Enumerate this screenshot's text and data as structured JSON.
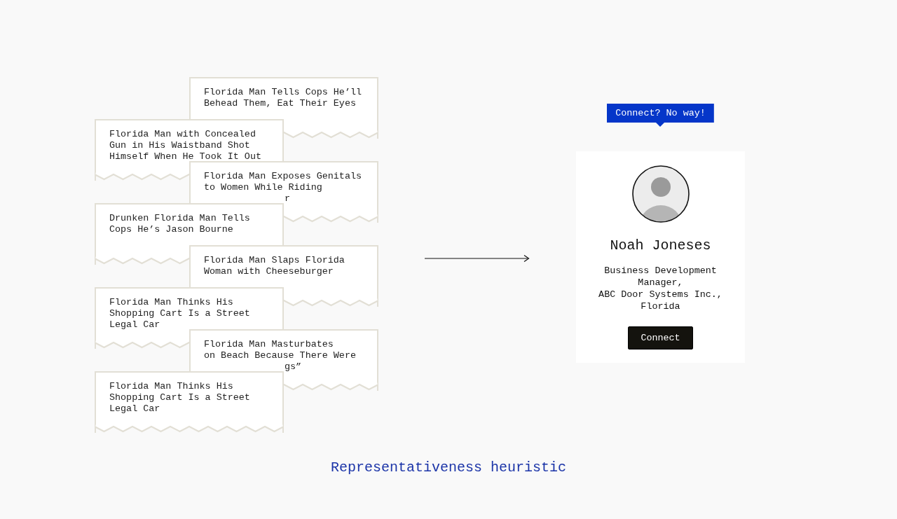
{
  "headlines": [
    {
      "lines": [
        {
          "kind": "full",
          "text": "Florida Man Tells Cops He’ll"
        },
        {
          "kind": "full",
          "text": "Behead Them, Eat Their Eyes"
        }
      ]
    },
    {
      "lines": [
        {
          "kind": "full",
          "text": "Florida Man with Concealed"
        },
        {
          "kind": "full",
          "text": "Gun in His Waistband Shot"
        },
        {
          "kind": "full",
          "text": "Himself When He Took It Out"
        }
      ]
    },
    {
      "lines": [
        {
          "kind": "full",
          "text": "Florida Man Exposes Genitals"
        },
        {
          "kind": "full",
          "text": "to Women While Riding"
        },
        {
          "kind": "fragment",
          "text": "r"
        }
      ]
    },
    {
      "lines": [
        {
          "kind": "full",
          "text": "Drunken Florida Man Tells"
        },
        {
          "kind": "full",
          "text": "Cops He’s Jason Bourne"
        }
      ]
    },
    {
      "lines": [
        {
          "kind": "full",
          "text": "Florida Man Slaps Florida"
        },
        {
          "kind": "full",
          "text": "Woman with Cheeseburger"
        }
      ]
    },
    {
      "lines": [
        {
          "kind": "full",
          "text": "Florida Man Thinks His"
        },
        {
          "kind": "full",
          "text": "Shopping Cart Is a Street"
        },
        {
          "kind": "full",
          "text": "Legal Car"
        }
      ]
    },
    {
      "lines": [
        {
          "kind": "full",
          "text": "Florida Man Masturbates"
        },
        {
          "kind": "full",
          "text": "on Beach Because There Were"
        },
        {
          "kind": "fragment",
          "text": "gs”"
        }
      ]
    },
    {
      "lines": [
        {
          "kind": "full",
          "text": "Florida Man Thinks His"
        },
        {
          "kind": "full",
          "text": "Shopping Cart Is a Street"
        },
        {
          "kind": "full",
          "text": "Legal Car"
        }
      ]
    }
  ],
  "tooltip": {
    "text": "Connect? No way!"
  },
  "profile": {
    "name": "Noah Joneses",
    "title_lines": [
      "Business Development",
      "Manager,",
      "ABC Door Systems Inc.,",
      "Florida"
    ],
    "button": "Connect"
  },
  "caption": "Representativeness heuristic"
}
